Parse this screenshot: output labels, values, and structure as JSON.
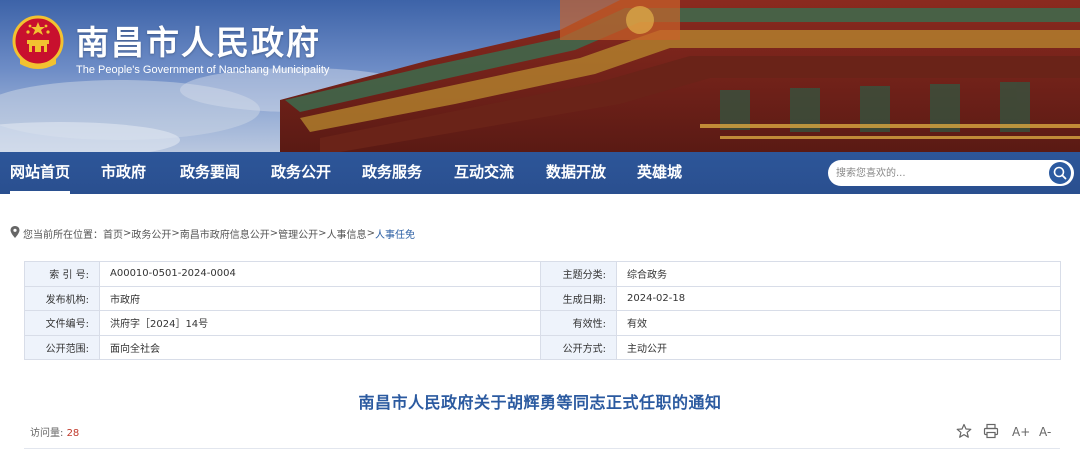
{
  "header": {
    "title": "南昌市人民政府",
    "subtitle": "The People's Government of Nanchang Municipality"
  },
  "nav": {
    "items": [
      {
        "label": "网站首页",
        "active": true
      },
      {
        "label": "市政府"
      },
      {
        "label": "政务要闻"
      },
      {
        "label": "政务公开"
      },
      {
        "label": "政务服务"
      },
      {
        "label": "互动交流"
      },
      {
        "label": "数据开放"
      },
      {
        "label": "英雄城"
      }
    ],
    "search_placeholder": "搜索您喜欢的..."
  },
  "breadcrumb": {
    "prefix": "您当前所在位置：",
    "items": [
      "首页",
      "政务公开",
      "南昌市政府信息公开",
      "管理公开",
      "人事信息",
      "人事任免"
    ],
    "separator": ">"
  },
  "info": {
    "rows": [
      {
        "l1": "索 引 号:",
        "v1": "A00010-0501-2024-0004",
        "l2": "主题分类:",
        "v2": "综合政务"
      },
      {
        "l1": "发布机构:",
        "v1": "市政府",
        "l2": "生成日期:",
        "v2": "2024-02-18"
      },
      {
        "l1": "文件编号:",
        "v1": "洪府字［2024］14号",
        "l2": "有效性:",
        "v2": "有效"
      },
      {
        "l1": "公开范围:",
        "v1": "面向全社会",
        "l2": "公开方式:",
        "v2": "主动公开"
      }
    ]
  },
  "article": {
    "title": "南昌市人民政府关于胡辉勇等同志正式任职的通知",
    "visits_label": "访问量:",
    "visits_count": "28",
    "tools": [
      "star-icon",
      "print-icon",
      "font-increase-icon",
      "font-decrease-icon"
    ],
    "font_up_label": "A+",
    "font_down_label": "A-"
  },
  "colors": {
    "nav_bg": "#2d5699",
    "accent": "#2b5aa0",
    "visits_count": "#c0392b",
    "label_bg": "#eef3fb"
  }
}
